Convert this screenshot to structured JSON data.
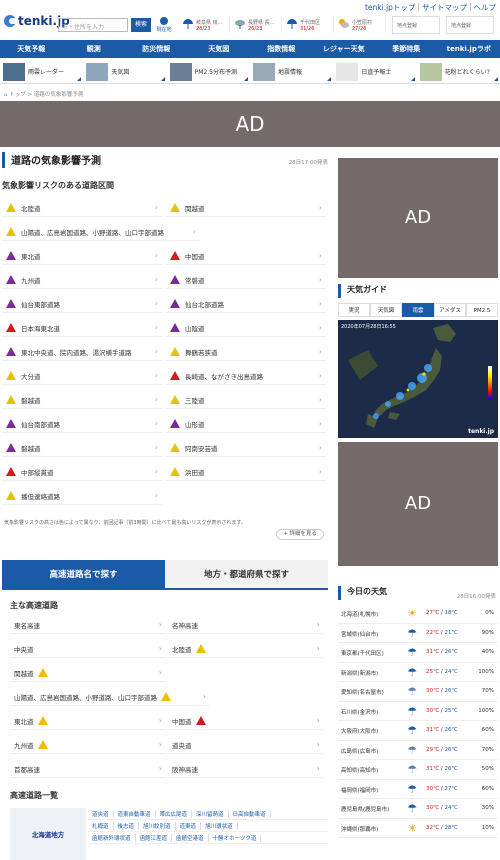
{
  "top_links": {
    "home": "tenki.jpトップ",
    "sitemap": "サイトマップ",
    "help": "ヘルプ"
  },
  "header": {
    "logo": "tenki.jp",
    "search_placeholder": "市・住所を入力",
    "search_button": "検索",
    "location_button": "現在地",
    "forecasts": [
      {
        "label": "岐阜県 岐…",
        "temp": "28/23"
      },
      {
        "label": "長野県 長…",
        "temp": "26/23"
      },
      {
        "label": "千代田区",
        "temp": "31/26"
      },
      {
        "label": "小笠原村",
        "temp": "27/26"
      }
    ],
    "slots": [
      "地点登録",
      "地点登録"
    ]
  },
  "nav": [
    "天気予報",
    "観測",
    "防災情報",
    "天気図",
    "指数情報",
    "レジャー天気",
    "季節特集",
    "tenki.jpラボ"
  ],
  "subnav": [
    {
      "label": "雨雲レーダー"
    },
    {
      "label": "天気図"
    },
    {
      "label": "PM2.5分布予測"
    },
    {
      "label": "地震情報"
    },
    {
      "label": "日直予報士"
    },
    {
      "label": "花粉どれくらい?"
    }
  ],
  "breadcrumb": "トップ > 道路の気象影響予測",
  "ad_label": "AD",
  "page": {
    "title": "道路の気象影響予測",
    "time": "28日17:00発表",
    "risk_title": "気象影響リスクのある道路区間"
  },
  "roads": [
    {
      "name": "北陸道",
      "level": "yellow"
    },
    {
      "name": "関越道",
      "level": "yellow"
    },
    {
      "name": "山陽道、広島岩国道路、小野道路、山口宇部道路",
      "level": "yellow",
      "wide": true
    },
    {
      "name": "東北道",
      "level": "purple"
    },
    {
      "name": "中国道",
      "level": "red"
    },
    {
      "name": "九州道",
      "level": "purple"
    },
    {
      "name": "常磐道",
      "level": "purple"
    },
    {
      "name": "仙台東部道路",
      "level": "purple"
    },
    {
      "name": "仙台北部道路",
      "level": "purple"
    },
    {
      "name": "日本海東北道",
      "level": "red"
    },
    {
      "name": "山陰道",
      "level": "purple"
    },
    {
      "name": "東北中央道、院内道路、湯沢横手道路",
      "level": "purple"
    },
    {
      "name": "舞鶴若狭道",
      "level": "yellow"
    },
    {
      "name": "大分道",
      "level": "yellow"
    },
    {
      "name": "長崎道、ながさき出島道路",
      "level": "red"
    },
    {
      "name": "磐越道",
      "level": "yellow"
    },
    {
      "name": "三陸道",
      "level": "yellow"
    },
    {
      "name": "仙台南部道路",
      "level": "purple"
    },
    {
      "name": "山形道",
      "level": "purple"
    },
    {
      "name": "磐越道",
      "level": "purple"
    },
    {
      "name": "阿南安芸道",
      "level": "yellow"
    },
    {
      "name": "中部縦貫道",
      "level": "red"
    },
    {
      "name": "浜田道",
      "level": "yellow"
    },
    {
      "name": "播但連絡道路",
      "level": "yellow"
    }
  ],
  "note": "気象影響リスクの高さは色によって異なり、前回記事（前3時間）に比べて最も高いリスクが表示されます。",
  "more_button": "+ 詳細を見る",
  "tabs": {
    "active": "高速道路名で探す",
    "inactive": "地方・都道府県で探す"
  },
  "highways_title": "主な高速道路",
  "highways": [
    {
      "name": "東名高速",
      "tri": ""
    },
    {
      "name": "名神高速",
      "tri": ""
    },
    {
      "name": "中央道",
      "tri": ""
    },
    {
      "name": "北陸道",
      "tri": "yellow"
    },
    {
      "name": "関越道",
      "tri": "yellow"
    },
    {
      "name": "山陽道、広島岩国道路、小野道路、山口宇部道路",
      "tri": "yellow",
      "wide": true
    },
    {
      "name": "東北道",
      "tri": "yellow"
    },
    {
      "name": "中国道",
      "tri": "red"
    },
    {
      "name": "九州道",
      "tri": "yellow"
    },
    {
      "name": "道央道",
      "tri": ""
    },
    {
      "name": "首都高速",
      "tri": ""
    },
    {
      "name": "阪神高速",
      "tri": ""
    }
  ],
  "list_title": "高速道路一覧",
  "region": "北海道地方",
  "road_links": [
    [
      "道央道",
      "道東自動車道",
      "帯広広尾道",
      "深川留萌道",
      "日高自動車道"
    ],
    [
      "札樽道",
      "後志道",
      "旭川紋別道",
      "道東道",
      "旭川環状道"
    ],
    [
      "函館新外環状道",
      "函館江差道",
      "函館空港道",
      "十勝オホーツク道"
    ]
  ],
  "guide": {
    "title": "天気ガイド",
    "tabs": [
      "実況",
      "天気図",
      "雨雲",
      "アメダス",
      "PM2.5"
    ],
    "active_tab": 2,
    "stamp": "2020年07月28日16:55",
    "brand": "tenki.jp"
  },
  "today": {
    "title": "今日の天気",
    "time": "28日16:00発表",
    "rows": [
      {
        "city": "北海道(札幌市)",
        "icon": "sun-cloud",
        "hi": "27℃",
        "lo": "18℃",
        "pct": "0%"
      },
      {
        "city": "宮城県(仙台市)",
        "icon": "umbrella",
        "hi": "22℃",
        "lo": "21℃",
        "pct": "90%"
      },
      {
        "city": "東京都(千代田区)",
        "icon": "umbrella",
        "hi": "31℃",
        "lo": "26℃",
        "pct": "40%"
      },
      {
        "city": "新潟県(新潟市)",
        "icon": "umbrella",
        "hi": "25℃",
        "lo": "24℃",
        "pct": "100%"
      },
      {
        "city": "愛知県(名古屋市)",
        "icon": "cloud-umbrella",
        "hi": "30℃",
        "lo": "26℃",
        "pct": "70%"
      },
      {
        "city": "石川県(金沢市)",
        "icon": "umbrella",
        "hi": "30℃",
        "lo": "25℃",
        "pct": "100%"
      },
      {
        "city": "大阪府(大阪市)",
        "icon": "umbrella",
        "hi": "31℃",
        "lo": "26℃",
        "pct": "60%"
      },
      {
        "city": "広島県(広島市)",
        "icon": "cloud-umbrella",
        "hi": "29℃",
        "lo": "26℃",
        "pct": "70%"
      },
      {
        "city": "高知県(高知市)",
        "icon": "cloud-umbrella",
        "hi": "31℃",
        "lo": "26℃",
        "pct": "50%"
      },
      {
        "city": "福岡県(福岡市)",
        "icon": "umbrella",
        "hi": "30℃",
        "lo": "27℃",
        "pct": "60%"
      },
      {
        "city": "鹿児島県(鹿児島市)",
        "icon": "umbrella",
        "hi": "30℃",
        "lo": "24℃",
        "pct": "30%"
      },
      {
        "city": "沖縄県(那覇市)",
        "icon": "sun-cloud",
        "hi": "32℃",
        "lo": "28℃",
        "pct": "10%"
      }
    ]
  }
}
